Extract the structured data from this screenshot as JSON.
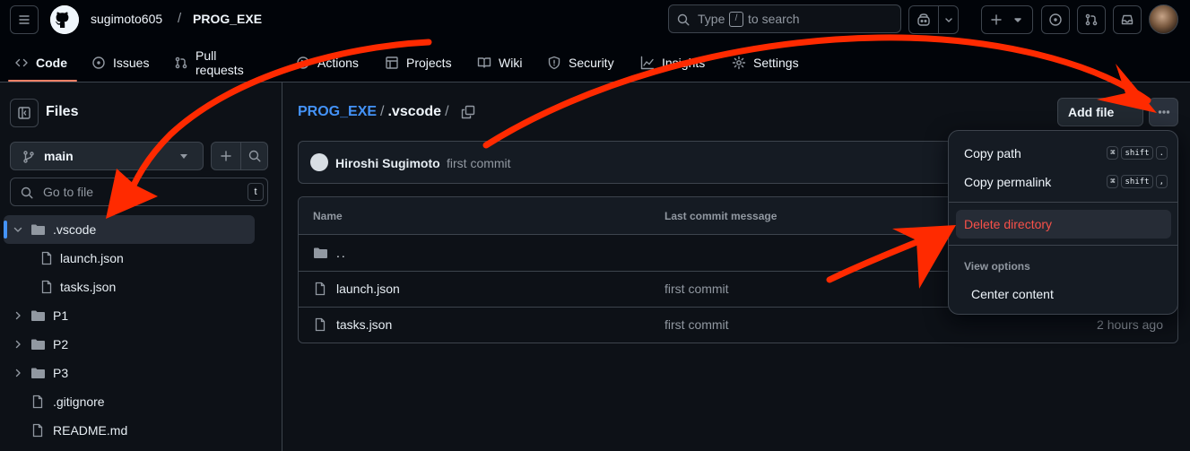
{
  "header": {
    "owner": "sugimoto605",
    "separator": "/",
    "repo": "PROG_EXE",
    "search": {
      "prefix": "Type",
      "key": "/",
      "suffix": "to search"
    }
  },
  "repo_nav": {
    "tabs": [
      {
        "id": "code",
        "label": "Code",
        "icon": "code-icon",
        "active": true
      },
      {
        "id": "issues",
        "label": "Issues",
        "icon": "issue-opened-icon"
      },
      {
        "id": "pulls",
        "label": "Pull requests",
        "icon": "git-pull-request-icon"
      },
      {
        "id": "actions",
        "label": "Actions",
        "icon": "play-icon"
      },
      {
        "id": "projects",
        "label": "Projects",
        "icon": "table-icon"
      },
      {
        "id": "wiki",
        "label": "Wiki",
        "icon": "book-icon"
      },
      {
        "id": "security",
        "label": "Security",
        "icon": "shield-icon"
      },
      {
        "id": "insights",
        "label": "Insights",
        "icon": "graph-icon"
      },
      {
        "id": "settings",
        "label": "Settings",
        "icon": "gear-icon"
      }
    ]
  },
  "sidebar": {
    "title": "Files",
    "branch": "main",
    "goto": {
      "placeholder": "Go to file",
      "key": "t"
    },
    "tree": [
      {
        "label": ".vscode",
        "type": "folder",
        "expanded": true,
        "selected": true,
        "depth": 0
      },
      {
        "label": "launch.json",
        "type": "file",
        "depth": 1
      },
      {
        "label": "tasks.json",
        "type": "file",
        "depth": 1
      },
      {
        "label": "P1",
        "type": "folder",
        "expanded": false,
        "depth": 0
      },
      {
        "label": "P2",
        "type": "folder",
        "expanded": false,
        "depth": 0
      },
      {
        "label": "P3",
        "type": "folder",
        "expanded": false,
        "depth": 0
      },
      {
        "label": ".gitignore",
        "type": "file",
        "depth": 0,
        "flat": true
      },
      {
        "label": "README.md",
        "type": "file",
        "depth": 0,
        "flat": true
      }
    ]
  },
  "main": {
    "breadcrumb": {
      "root": "PROG_EXE",
      "sep": "/",
      "current": ".vscode",
      "trail": "/"
    },
    "add_file_label": "Add file",
    "commit": {
      "author": "Hiroshi Sugimoto",
      "message": "first commit"
    },
    "table": {
      "headers": {
        "name": "Name",
        "message": "Last commit message"
      },
      "rows": [
        {
          "name": "..",
          "type": "parent",
          "message": "",
          "date": ""
        },
        {
          "name": "launch.json",
          "type": "file",
          "message": "first commit",
          "date": ""
        },
        {
          "name": "tasks.json",
          "type": "file",
          "message": "first commit",
          "date": "2 hours ago"
        }
      ]
    }
  },
  "menu": {
    "copy_path": {
      "label": "Copy path",
      "keys": [
        "⌘",
        "shift",
        "."
      ]
    },
    "copy_permalink": {
      "label": "Copy permalink",
      "keys": [
        "⌘",
        "shift",
        ","
      ]
    },
    "delete_directory": {
      "label": "Delete directory"
    },
    "view_options_heading": "View options",
    "center_content": {
      "label": "Center content"
    }
  },
  "colors": {
    "accent_link": "#4493f8",
    "danger": "#f85149",
    "tab_underline": "#f78166",
    "annotation_red": "#ff2a00"
  }
}
